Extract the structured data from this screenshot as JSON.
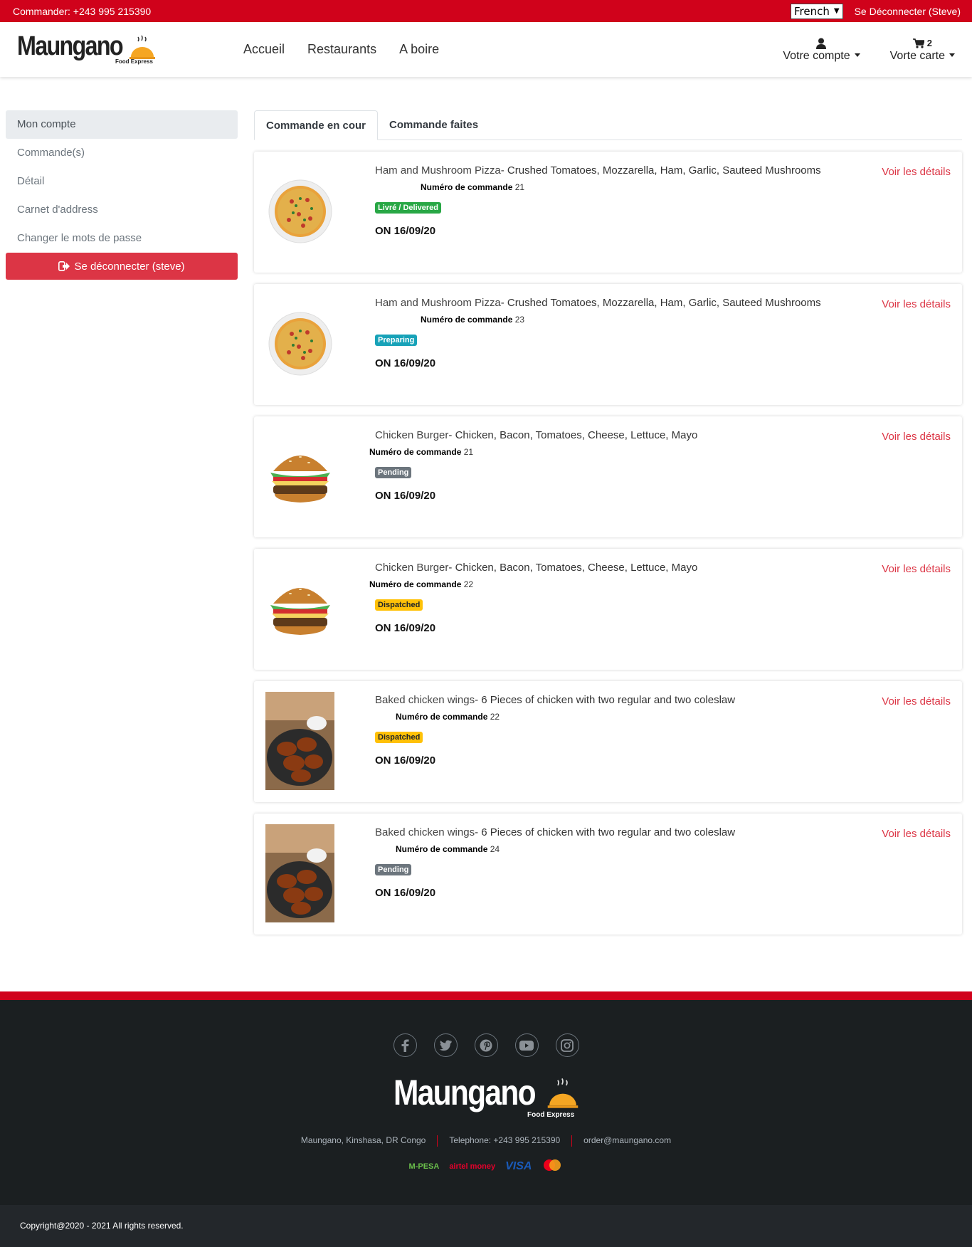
{
  "topbar": {
    "phone": "Commander: +243 995 215390",
    "language": "French",
    "logout": "Se Déconnecter (Steve)"
  },
  "header": {
    "logo": "Maungano",
    "logo_sub": "Food Express",
    "nav": [
      "Accueil",
      "Restaurants",
      "A boire"
    ],
    "account": "Votre compte",
    "cart": "Vorte carte",
    "cart_count": "2"
  },
  "sidebar": {
    "items": [
      "Mon compte",
      "Commande(s)",
      "Détail",
      "Carnet d'address",
      "Changer le mots de passe"
    ],
    "logout": "Se déconnecter (steve)"
  },
  "tabs": [
    "Commande en cour",
    "Commande faites"
  ],
  "orders": [
    {
      "name": "Ham and Mushroom Pizza",
      "desc": "Crushed Tomatoes, Mozzarella, Ham, Garlic, Sauteed Mushrooms",
      "order_label": "Numéro de commande",
      "order_no": "21",
      "status": "Livré / Delivered",
      "date": "ON 16/09/20",
      "link": "Voir les détails",
      "image": "pizza-image"
    },
    {
      "name": "Ham and Mushroom Pizza",
      "desc": "Crushed Tomatoes, Mozzarella, Ham, Garlic, Sauteed Mushrooms",
      "order_label": "Numéro de commande",
      "order_no": "23",
      "status": "Preparing",
      "date": "ON 16/09/20",
      "link": "Voir les détails",
      "image": "pizza-image"
    },
    {
      "name": "Chicken Burger",
      "desc": "Chicken, Bacon, Tomatoes, Cheese, Lettuce, Mayo",
      "order_label": "Numéro de commande",
      "order_no": "21",
      "status": "Pending",
      "date": "ON 16/09/20",
      "link": "Voir les détails",
      "image": "burger-image"
    },
    {
      "name": "Chicken Burger",
      "desc": "Chicken, Bacon, Tomatoes, Cheese, Lettuce, Mayo",
      "order_label": "Numéro de commande",
      "order_no": "22",
      "status": "Dispatched",
      "date": "ON 16/09/20",
      "link": "Voir les détails",
      "image": "burger-image"
    },
    {
      "name": "Baked chicken wings",
      "desc": "6 Pieces of chicken with two regular and two coleslaw",
      "order_label": "Numéro de commande",
      "order_no": "22",
      "status": "Dispatched",
      "date": "ON 16/09/20",
      "link": "Voir les détails",
      "image": "wings-image"
    },
    {
      "name": "Baked chicken wings",
      "desc": "6 Pieces of chicken with two regular and two coleslaw",
      "order_label": "Numéro de commande",
      "order_no": "24",
      "status": "Pending",
      "date": "ON 16/09/20",
      "link": "Voir les détails",
      "image": "wings-image"
    }
  ],
  "footer": {
    "socials": [
      "facebook-icon",
      "twitter-icon",
      "pinterest-icon",
      "youtube-icon",
      "instagram-icon"
    ],
    "logo": "Maungano",
    "logo_sub": "Food Express",
    "address": "Maungano, Kinshasa, DR Congo",
    "phone": "Telephone: +243 995 215390",
    "email": "order@maungano.com",
    "payments": [
      "M-PESA",
      "airtel money",
      "VISA",
      "MasterCard"
    ],
    "copyright": "Copyright@2020 - 2021 All rights reserved."
  },
  "colors": {
    "brand_red": "#d0021b",
    "danger": "#dc3545",
    "delivered": "#28a745",
    "preparing": "#17a2b8",
    "pending": "#6c757d",
    "dispatched": "#ffc107",
    "footer_bg": "#1b1f21"
  }
}
